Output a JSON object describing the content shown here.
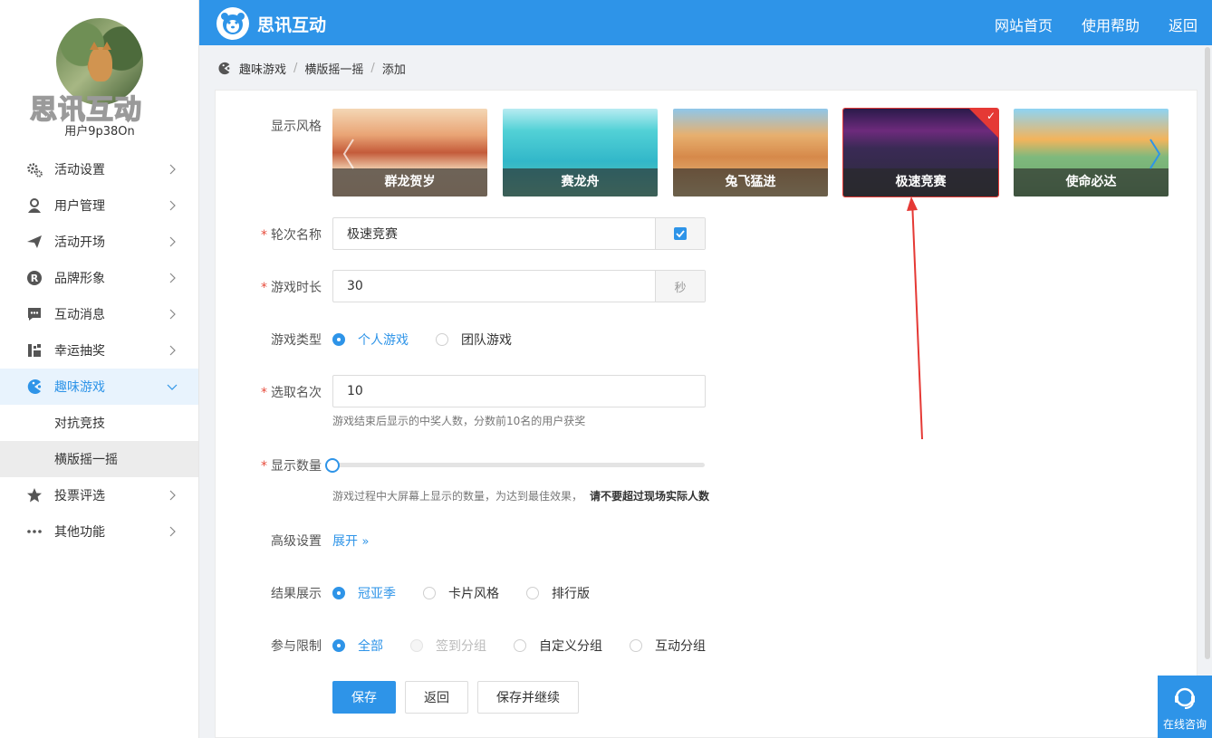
{
  "sidebar": {
    "brand_text": "思讯互动",
    "username": "用户9p38On",
    "menu": [
      {
        "label": "活动设置",
        "icon": "gears-icon"
      },
      {
        "label": "用户管理",
        "icon": "user-icon"
      },
      {
        "label": "活动开场",
        "icon": "paper-plane-icon"
      },
      {
        "label": "品牌形象",
        "icon": "registered-icon"
      },
      {
        "label": "互动消息",
        "icon": "chat-icon"
      },
      {
        "label": "幸运抽奖",
        "icon": "lottery-icon"
      },
      {
        "label": "趣味游戏",
        "icon": "gamepad-icon"
      },
      {
        "label": "投票评选",
        "icon": "star-icon"
      },
      {
        "label": "其他功能",
        "icon": "more-icon"
      }
    ],
    "submenu": [
      "对抗竞技",
      "横版摇一摇"
    ]
  },
  "header": {
    "title": "思讯互动",
    "nav": [
      "网站首页",
      "使用帮助",
      "返回"
    ]
  },
  "breadcrumb": [
    "趣味游戏",
    "横版摇一摇",
    "添加"
  ],
  "form": {
    "style_label": "显示风格",
    "styles": [
      "群龙贺岁",
      "赛龙舟",
      "兔飞猛进",
      "极速竞赛",
      "使命必达"
    ],
    "selected_style": "极速竞赛",
    "round_name_label": "轮次名称",
    "round_name_value": "极速竞赛",
    "duration_label": "游戏时长",
    "duration_value": "30",
    "duration_unit": "秒",
    "game_type_label": "游戏类型",
    "game_type_options": [
      "个人游戏",
      "团队游戏"
    ],
    "game_type_selected": "个人游戏",
    "winners_label": "选取名次",
    "winners_value": "10",
    "winners_hint": "游戏结束后显示的中奖人数，分数前10名的用户获奖",
    "display_count_label": "显示数量",
    "display_count_value": 0,
    "display_count_hint": "游戏过程中大屏幕上显示的数量，为达到最佳效果，",
    "display_count_hint_bold": "请不要超过现场实际人数",
    "advanced_label": "高级设置",
    "advanced_link": "展开",
    "result_label": "结果展示",
    "result_options": [
      "冠亚季",
      "卡片风格",
      "排行版"
    ],
    "result_selected": "冠亚季",
    "limit_label": "参与限制",
    "limit_options": [
      "全部",
      "签到分组",
      "自定义分组",
      "互动分组"
    ],
    "limit_selected": "全部",
    "limit_disabled": "签到分组"
  },
  "buttons": {
    "save": "保存",
    "back": "返回",
    "save_continue": "保存并继续"
  },
  "consult": "在线咨询",
  "colors": {
    "primary": "#2e94e8",
    "danger": "#e53935"
  }
}
